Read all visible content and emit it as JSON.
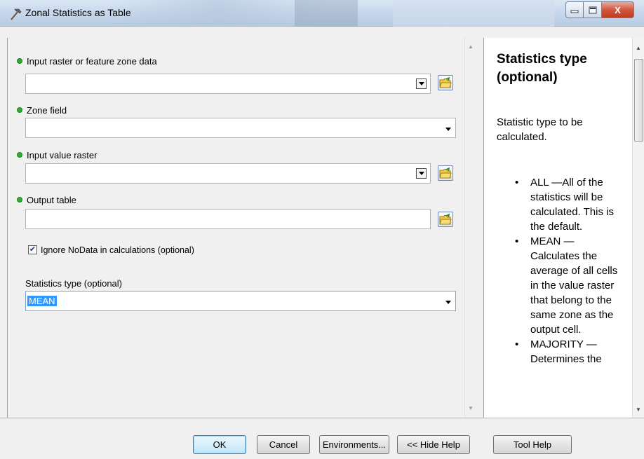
{
  "window": {
    "title": "Zonal Statistics as Table",
    "close_glyph": "X"
  },
  "form": {
    "input_zone": {
      "label": "Input raster or feature zone data",
      "value": ""
    },
    "zone_field": {
      "label": "Zone field",
      "value": ""
    },
    "input_value": {
      "label": "Input value raster",
      "value": ""
    },
    "output_table": {
      "label": "Output table",
      "value": ""
    },
    "ignore_nodata": {
      "label": "Ignore NoData in calculations (optional)",
      "checked": true
    },
    "statistics_type": {
      "label": "Statistics type (optional)",
      "value": "MEAN"
    }
  },
  "help": {
    "title": "Statistics type (optional)",
    "description": "Statistic type to be calculated.",
    "items": [
      "ALL —All of the statistics will be calculated. This is the default.",
      "MEAN — Calculates the average of all cells in the value raster that belong to the same zone as the output cell.",
      "MAJORITY — Determines the"
    ]
  },
  "buttons": {
    "ok": "OK",
    "cancel": "Cancel",
    "environments": "Environments...",
    "hide_help": "<< Hide Help",
    "tool_help": "Tool Help"
  },
  "icons": {
    "app": "hammer-icon",
    "browse": "open-folder-icon",
    "required": "green-dot-icon"
  },
  "colors": {
    "required_dot": "#2fae2f",
    "selection": "#3399ff",
    "close_button": "#c23b22"
  }
}
